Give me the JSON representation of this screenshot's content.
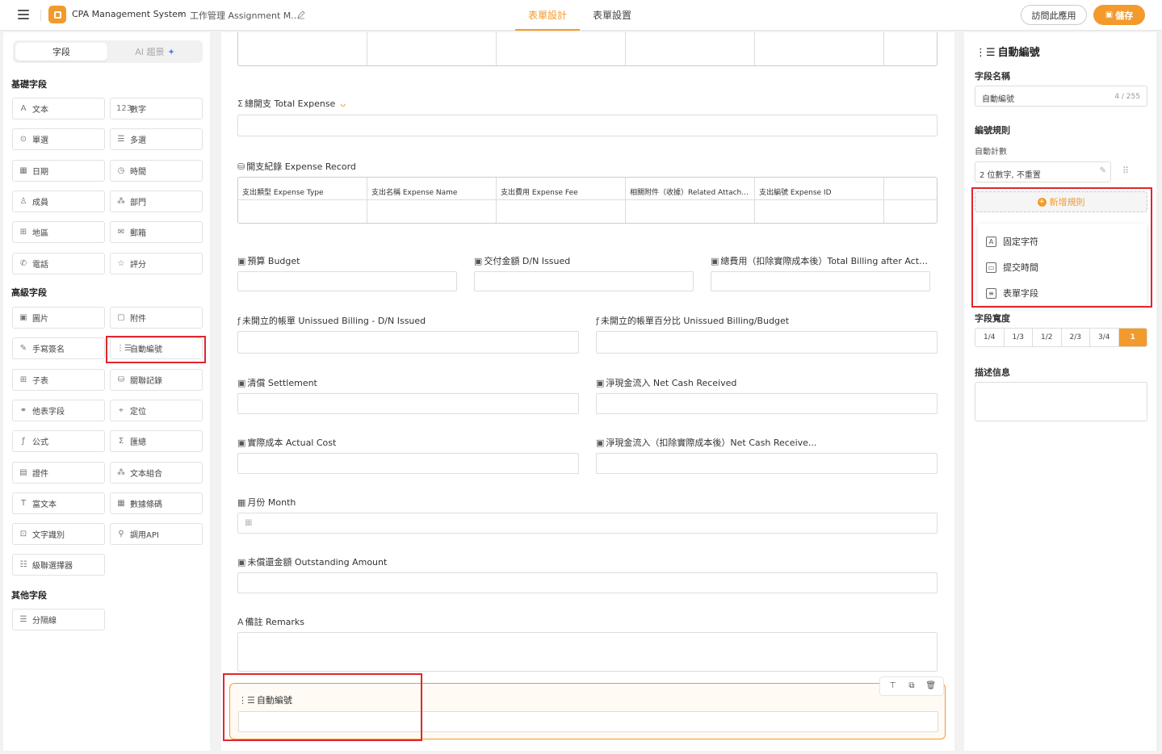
{
  "header": {
    "app_name": "CPA Management System",
    "breadcrumb_sep": "›",
    "breadcrumb_item": "工作管理 Assignment M...",
    "tabs": [
      "表單設計",
      "表單設置"
    ],
    "active_tab": "表單設計",
    "visit_label": "訪問此應用",
    "save_label": "儲存",
    "accent_color": "#f39a2c"
  },
  "left": {
    "tab_fields": "字段",
    "tab_ai": "AI 趨景",
    "basic_title": "基礎字段",
    "basic": [
      {
        "label": "文本",
        "icon": "text-icon",
        "glyph": "A"
      },
      {
        "label": "數字",
        "icon": "number-icon",
        "glyph": "123"
      },
      {
        "label": "單選",
        "icon": "radio-icon",
        "glyph": "⊙"
      },
      {
        "label": "多選",
        "icon": "checklist-icon",
        "glyph": "☰"
      },
      {
        "label": "日期",
        "icon": "calendar-icon",
        "glyph": "▦"
      },
      {
        "label": "時間",
        "icon": "clock-icon",
        "glyph": "◷"
      },
      {
        "label": "成員",
        "icon": "user-icon",
        "glyph": "♙"
      },
      {
        "label": "部門",
        "icon": "org-icon",
        "glyph": "⁂"
      },
      {
        "label": "地區",
        "icon": "map-icon",
        "glyph": "⊞"
      },
      {
        "label": "郵箱",
        "icon": "mail-icon",
        "glyph": "✉"
      },
      {
        "label": "電話",
        "icon": "phone-icon",
        "glyph": "✆"
      },
      {
        "label": "評分",
        "icon": "star-icon",
        "glyph": "☆"
      }
    ],
    "advanced_title": "高級字段",
    "advanced": [
      {
        "label": "圖片",
        "icon": "image-icon",
        "glyph": "▣"
      },
      {
        "label": "附件",
        "icon": "file-icon",
        "glyph": "▢"
      },
      {
        "label": "手寫簽名",
        "icon": "pen-icon",
        "glyph": "✎"
      },
      {
        "label": "自動編號",
        "icon": "autonumber-icon",
        "glyph": "⋮☰"
      },
      {
        "label": "子表",
        "icon": "table-icon",
        "glyph": "⊞"
      },
      {
        "label": "關聯記錄",
        "icon": "database-icon",
        "glyph": "⛁"
      },
      {
        "label": "他表字段",
        "icon": "link-icon",
        "glyph": "⚭"
      },
      {
        "label": "定位",
        "icon": "location-icon",
        "glyph": "⌖"
      },
      {
        "label": "公式",
        "icon": "formula-icon",
        "glyph": "ƒ"
      },
      {
        "label": "匯總",
        "icon": "sum-icon",
        "glyph": "Σ"
      },
      {
        "label": "證件",
        "icon": "id-card-icon",
        "glyph": "▤"
      },
      {
        "label": "文本組合",
        "icon": "combine-icon",
        "glyph": "⁂"
      },
      {
        "label": "富文本",
        "icon": "richtext-icon",
        "glyph": "T"
      },
      {
        "label": "數據條碼",
        "icon": "qrcode-icon",
        "glyph": "▦"
      },
      {
        "label": "文字識別",
        "icon": "ocr-icon",
        "glyph": "⊡"
      },
      {
        "label": "調用API",
        "icon": "api-icon",
        "glyph": "⚲"
      },
      {
        "label": "級聯選擇器",
        "icon": "cascade-icon",
        "glyph": "☷"
      }
    ],
    "other_title": "其他字段",
    "other": [
      {
        "label": "分隔線",
        "icon": "divider-icon",
        "glyph": "☰"
      }
    ]
  },
  "canvas": {
    "total_expense_label": "總開支 Total Expense",
    "expense_record_label": "開支紀錄 Expense Record",
    "expense_columns": [
      "支出類型 Expense Type",
      "支出名稱 Expense Name",
      "支出費用 Expense Fee",
      "相關附件（收據）Related Attach...",
      "支出編號 Expense ID"
    ],
    "budget": "預算 Budget",
    "dn_issued": "交付金額 D/N Issued",
    "total_billing": "總費用（扣除實際成本後）Total Billing after Actu...",
    "unissued_billing": "未開立的帳單 Unissued Billing - D/N Issued",
    "unissued_pct": "未開立的帳單百分比 Unissued Billing/Budget",
    "settlement": "清償 Settlement",
    "net_cash": "淨現金流入 Net Cash Received",
    "actual_cost": "實際成本 Actual Cost",
    "net_cash_after": "淨現金流入（扣除實際成本後）Net Cash Receive...",
    "month": "月份 Month",
    "outstanding": "未償還金額 Outstanding Amount",
    "remarks": "備註 Remarks",
    "auto_number": "自動編號"
  },
  "right": {
    "title": "自動編號",
    "field_name_label": "字段名稱",
    "field_name_value": "自動編號",
    "field_name_count": "4 / 255",
    "rule_label": "編號規則",
    "counter_label": "自動計數",
    "counter_value": "2 位數字, 不重置",
    "add_rule": "新增規則",
    "dropdown": [
      "固定字符",
      "提交時間",
      "表單字段"
    ],
    "width_label": "字段寬度",
    "widths": [
      "1/4",
      "1/3",
      "1/2",
      "2/3",
      "3/4",
      "1"
    ],
    "desc_label": "描述信息"
  }
}
